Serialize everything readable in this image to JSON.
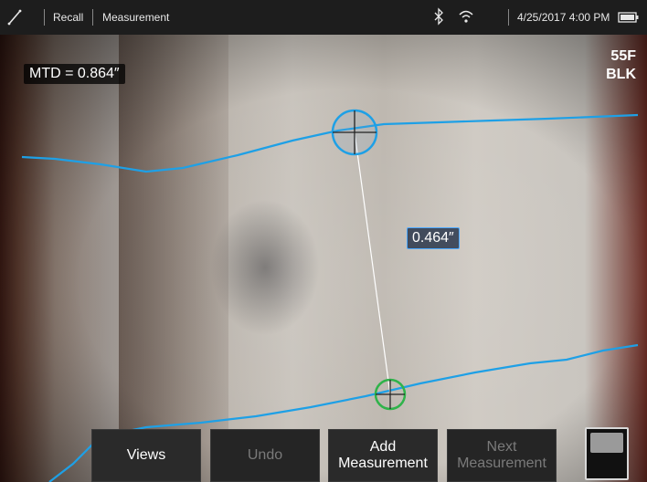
{
  "status_bar": {
    "mode_icon": "measurement-line-icon",
    "recall": "Recall",
    "measurement": "Measurement",
    "bluetooth_icon": "bluetooth-icon",
    "wifi_icon": "wifi-icon",
    "datetime": "4/25/2017 4:00 PM",
    "battery_icon": "battery-icon"
  },
  "camera": {
    "mtd_readout": "MTD = 0.864″",
    "segment_label": "0.464″",
    "corner_line1": "55F",
    "corner_line2": "BLK",
    "accent_color": "#1ea0e6",
    "cursor_bottom_color": "#2fb34a"
  },
  "softkeys": {
    "views": "Views",
    "undo": "Undo",
    "add_line1": "Add",
    "add_line2": "Measurement",
    "next_line1": "Next",
    "next_line2": "Measurement"
  },
  "toggle": {
    "icon": "view-toggle-icon"
  }
}
